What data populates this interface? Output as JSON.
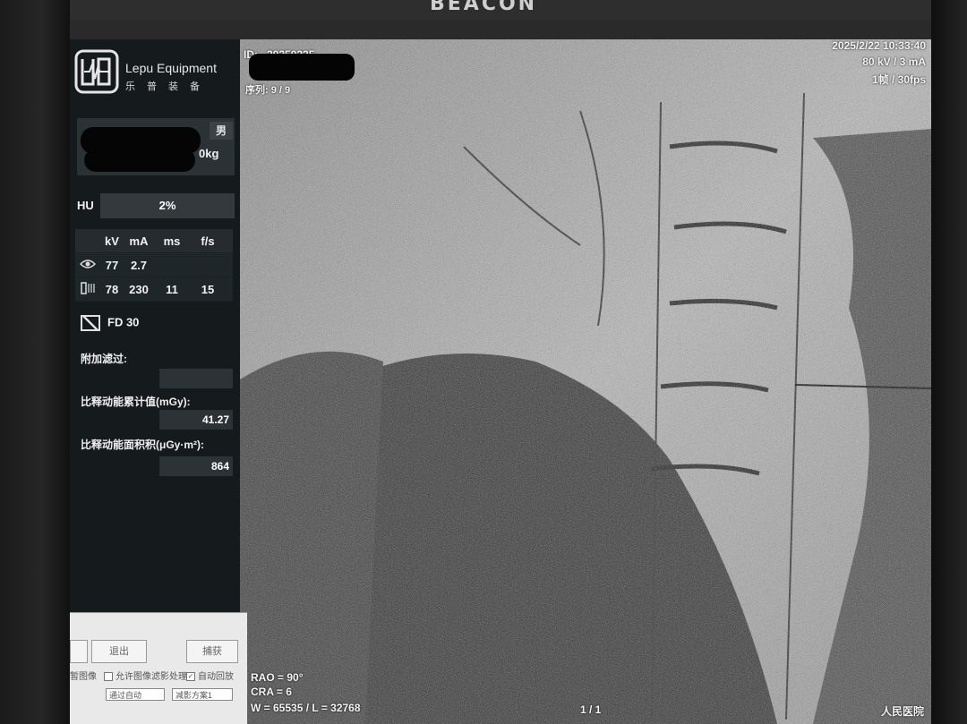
{
  "monitor": {
    "brand": "BEACON"
  },
  "sidebar": {
    "logo": {
      "name": "Lepu Equipment",
      "cn": "乐普装备"
    },
    "patient": {
      "sex": "男",
      "weight": "0kg"
    },
    "hu": {
      "label": "HU",
      "value": "2%"
    },
    "table": {
      "headers": [
        "kV",
        "mA",
        "ms",
        "f/s"
      ],
      "rows": [
        {
          "icon": "eye-icon",
          "values": [
            "77",
            "2.7",
            "",
            ""
          ]
        },
        {
          "icon": "tube-icon",
          "values": [
            "78",
            "230",
            "11",
            "15"
          ]
        }
      ]
    },
    "detector": "FD 30",
    "extra_filter_label": "附加滤过:",
    "extra_filter_value": "",
    "dose_label": "比释动能累计值(mGy):",
    "dose_value": "41.27",
    "dap_label": "比释动能面积积(μGy·m²):",
    "dap_value": "864"
  },
  "dialog": {
    "exit_label": "退出",
    "right_label": "捕获",
    "left_label": "暂图像",
    "chk1_label": "允许图像滤影处理",
    "chk2_label": "自动回放",
    "select1": "通过自动",
    "select2": "减影方案1"
  },
  "overlay": {
    "id_label": "ID:",
    "id_value": "20250225",
    "series": "序列: 9 / 9",
    "datetime": "2025/2/22 10:33:40",
    "exposure": "80 kV / 3 mA",
    "rate": "1帧 / 30fps",
    "rao": "RAO = 90°",
    "cra": "CRA = 6",
    "window": "W = 65535 / L = 32768",
    "frame": "1 / 1",
    "hospital": "人民医院"
  }
}
